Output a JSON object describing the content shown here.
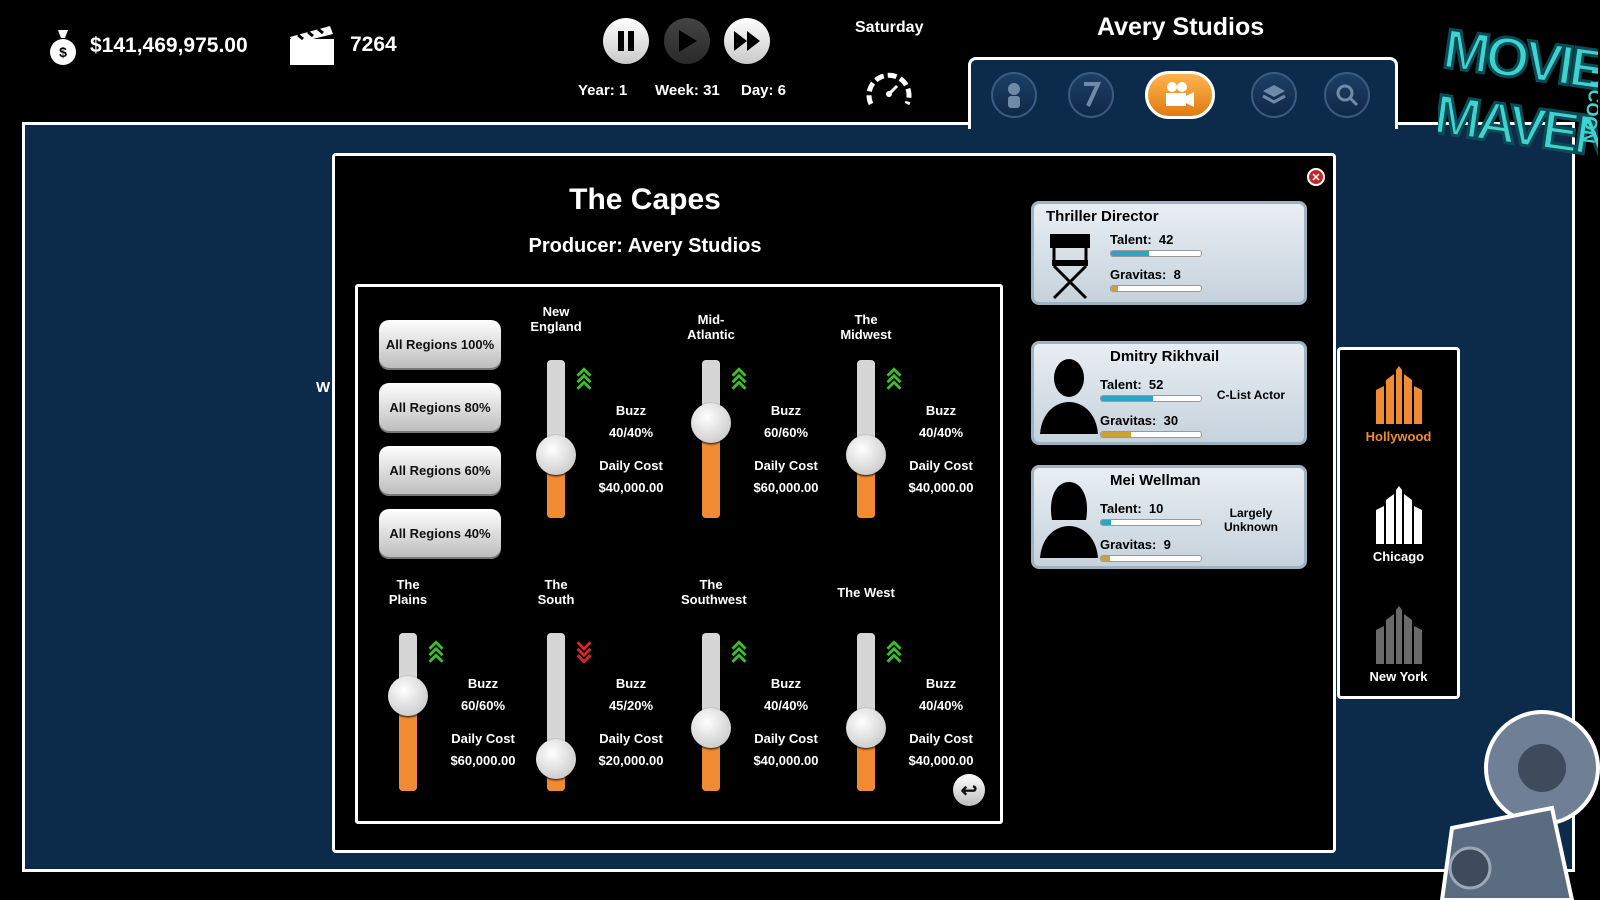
{
  "topbar": {
    "money": "$141,469,975.00",
    "reels": "7264",
    "day_name": "Saturday",
    "year": "Year: 1",
    "week": "Week: 31",
    "day": "Day: 6",
    "studio": "Avery Studios"
  },
  "film": {
    "title": "The Capes",
    "producer": "Producer: Avery Studios"
  },
  "all_regions": [
    "All Regions 100%",
    "All Regions 80%",
    "All Regions 60%",
    "All Regions 40%"
  ],
  "regions": [
    {
      "name": "New\nEngland",
      "buzz_label": "Buzz",
      "buzz": "40/40%",
      "cost_label": "Daily Cost",
      "cost": "$40,000.00",
      "level": 0.4,
      "trend": "up"
    },
    {
      "name": "Mid-Atlantic",
      "buzz_label": "Buzz",
      "buzz": "60/60%",
      "cost_label": "Daily Cost",
      "cost": "$60,000.00",
      "level": 0.6,
      "trend": "up"
    },
    {
      "name": "The Midwest",
      "buzz_label": "Buzz",
      "buzz": "40/40%",
      "cost_label": "Daily Cost",
      "cost": "$40,000.00",
      "level": 0.4,
      "trend": "up"
    },
    {
      "name": "The\nPlains",
      "buzz_label": "Buzz",
      "buzz": "60/60%",
      "cost_label": "Daily Cost",
      "cost": "$60,000.00",
      "level": 0.6,
      "trend": "up"
    },
    {
      "name": "The\nSouth",
      "buzz_label": "Buzz",
      "buzz": "45/20%",
      "cost_label": "Daily Cost",
      "cost": "$20,000.00",
      "level": 0.2,
      "trend": "down"
    },
    {
      "name": "The\nSouthwest",
      "buzz_label": "Buzz",
      "buzz": "40/40%",
      "cost_label": "Daily Cost",
      "cost": "$40,000.00",
      "level": 0.4,
      "trend": "up"
    },
    {
      "name": "The West",
      "buzz_label": "Buzz",
      "buzz": "40/40%",
      "cost_label": "Daily Cost",
      "cost": "$40,000.00",
      "level": 0.4,
      "trend": "up"
    }
  ],
  "crew": [
    {
      "title": "Thriller Director",
      "talent_label": "Talent:",
      "talent": "42",
      "gravitas_label": "Gravitas:",
      "gravitas": "8",
      "tier": ""
    },
    {
      "title": "Dmitry Rikhvail",
      "talent_label": "Talent:",
      "talent": "52",
      "gravitas_label": "Gravitas:",
      "gravitas": "30",
      "tier": "C-List Actor"
    },
    {
      "title": "Mei Wellman",
      "talent_label": "Talent:",
      "talent": "10",
      "gravitas_label": "Gravitas:",
      "gravitas": "9",
      "tier": "Largely\nUnknown"
    }
  ],
  "cities": [
    "Hollywood",
    "Chicago",
    "New York"
  ],
  "colors": {
    "accent": "#f08b33",
    "panel": "#0c2b4a",
    "talent_bar": "#2aa6c4",
    "gravitas_bar": "#c9a23a",
    "arrow_up": "#3bbf2a",
    "arrow_down": "#d9262b"
  }
}
